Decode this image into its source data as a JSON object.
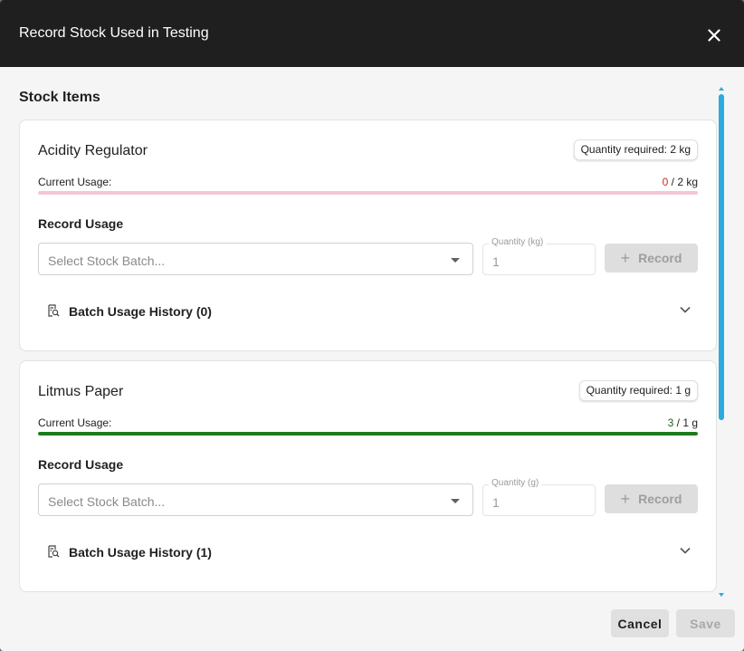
{
  "dialog": {
    "title": "Record Stock Used in Testing",
    "section_title": "Stock Items",
    "cancel_label": "Cancel",
    "save_label": "Save"
  },
  "items": [
    {
      "name": "Acidity Regulator",
      "quantity_required": "Quantity required: 2 kg",
      "usage_label": "Current Usage:",
      "usage_used": "0",
      "usage_total": " / 2 kg",
      "usage_fraction": 0,
      "record_title": "Record Usage",
      "select_placeholder": "Select Stock Batch...",
      "qty_label": "Quantity (kg)",
      "qty_value": "1",
      "record_label": "Record",
      "history_label": "Batch Usage History (0)"
    },
    {
      "name": "Litmus Paper",
      "quantity_required": "Quantity required: 1 g",
      "usage_label": "Current Usage:",
      "usage_used": "3",
      "usage_total": " / 1 g",
      "usage_fraction": 1,
      "record_title": "Record Usage",
      "select_placeholder": "Select Stock Batch...",
      "qty_label": "Quantity (g)",
      "qty_value": "1",
      "record_label": "Record",
      "history_label": "Batch Usage History (1)"
    }
  ],
  "colors": {
    "header_bg": "#1f1f1f",
    "accent_scroll": "#29abe2",
    "usage_under_track": "#f4c6d3",
    "usage_under_text": "#c62828",
    "usage_over_fill": "#1b7a1b",
    "usage_over_text": "#1b5e20"
  },
  "icons": {
    "close": "close-icon",
    "history": "batch-history-icon",
    "expand": "chevron-down-icon",
    "dropdown": "dropdown-arrow-icon",
    "add": "plus-icon"
  }
}
